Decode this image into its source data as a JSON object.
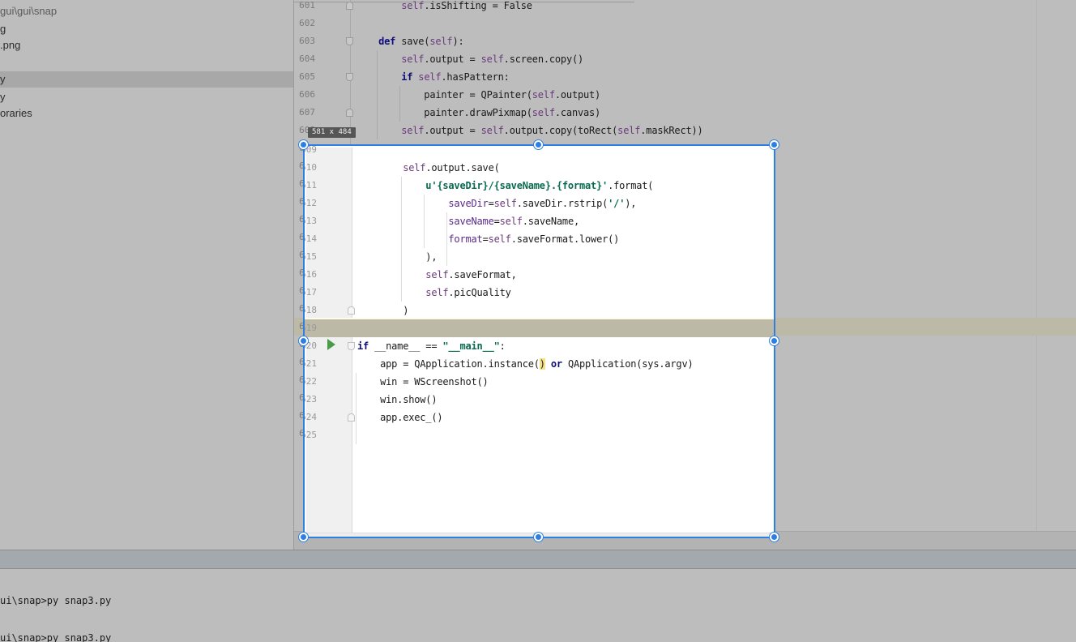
{
  "project_tree": {
    "path": "gui\\gui\\snap",
    "items": [
      "g",
      ".png",
      "y",
      "y",
      "oraries"
    ],
    "selected_index": 2
  },
  "editor": {
    "lines": [
      {
        "num": "601",
        "text": "        self.isShifting = False"
      },
      {
        "num": "602",
        "text": ""
      },
      {
        "num": "603",
        "text": "    def save(self):"
      },
      {
        "num": "604",
        "text": "        self.output = self.screen.copy()"
      },
      {
        "num": "605",
        "text": "        if self.hasPattern:"
      },
      {
        "num": "606",
        "text": "            painter = QPainter(self.output)"
      },
      {
        "num": "607",
        "text": "            painter.drawPixmap(self.canvas)"
      },
      {
        "num": "608",
        "text": "        self.output = self.output.copy(toRect(self.maskRect))"
      },
      {
        "num": "609",
        "text": ""
      },
      {
        "num": "610",
        "text": "        self.output.save("
      },
      {
        "num": "611",
        "text": "            u'{saveDir}/{saveName}.{format}'.format("
      },
      {
        "num": "612",
        "text": "                saveDir=self.saveDir.rstrip('/'),"
      },
      {
        "num": "613",
        "text": "                saveName=self.saveName,"
      },
      {
        "num": "614",
        "text": "                format=self.saveFormat.lower()"
      },
      {
        "num": "615",
        "text": "            ),"
      },
      {
        "num": "616",
        "text": "            self.saveFormat,"
      },
      {
        "num": "617",
        "text": "            self.picQuality"
      },
      {
        "num": "618",
        "text": "        )"
      },
      {
        "num": "619",
        "text": ""
      },
      {
        "num": "620",
        "text": "if __name__ == \"__main__\":"
      },
      {
        "num": "621",
        "text": "    app = QApplication.instance() or QApplication(sys.argv)"
      },
      {
        "num": "622",
        "text": "    win = WScreenshot()"
      },
      {
        "num": "623",
        "text": "    win.show()"
      },
      {
        "num": "624",
        "text": "    app.exec_()"
      },
      {
        "num": "625",
        "text": ""
      }
    ]
  },
  "selection": {
    "size_label": "581 x 484"
  },
  "terminal": {
    "lines": [
      "ui\\snap>py snap3.py",
      "ui\\snap>py snap3.py"
    ]
  },
  "colors": {
    "selection_border": "#2f7fe0",
    "keyword": "#0d0d7a",
    "self": "#6a3a7a",
    "string": "#0a6a50"
  }
}
